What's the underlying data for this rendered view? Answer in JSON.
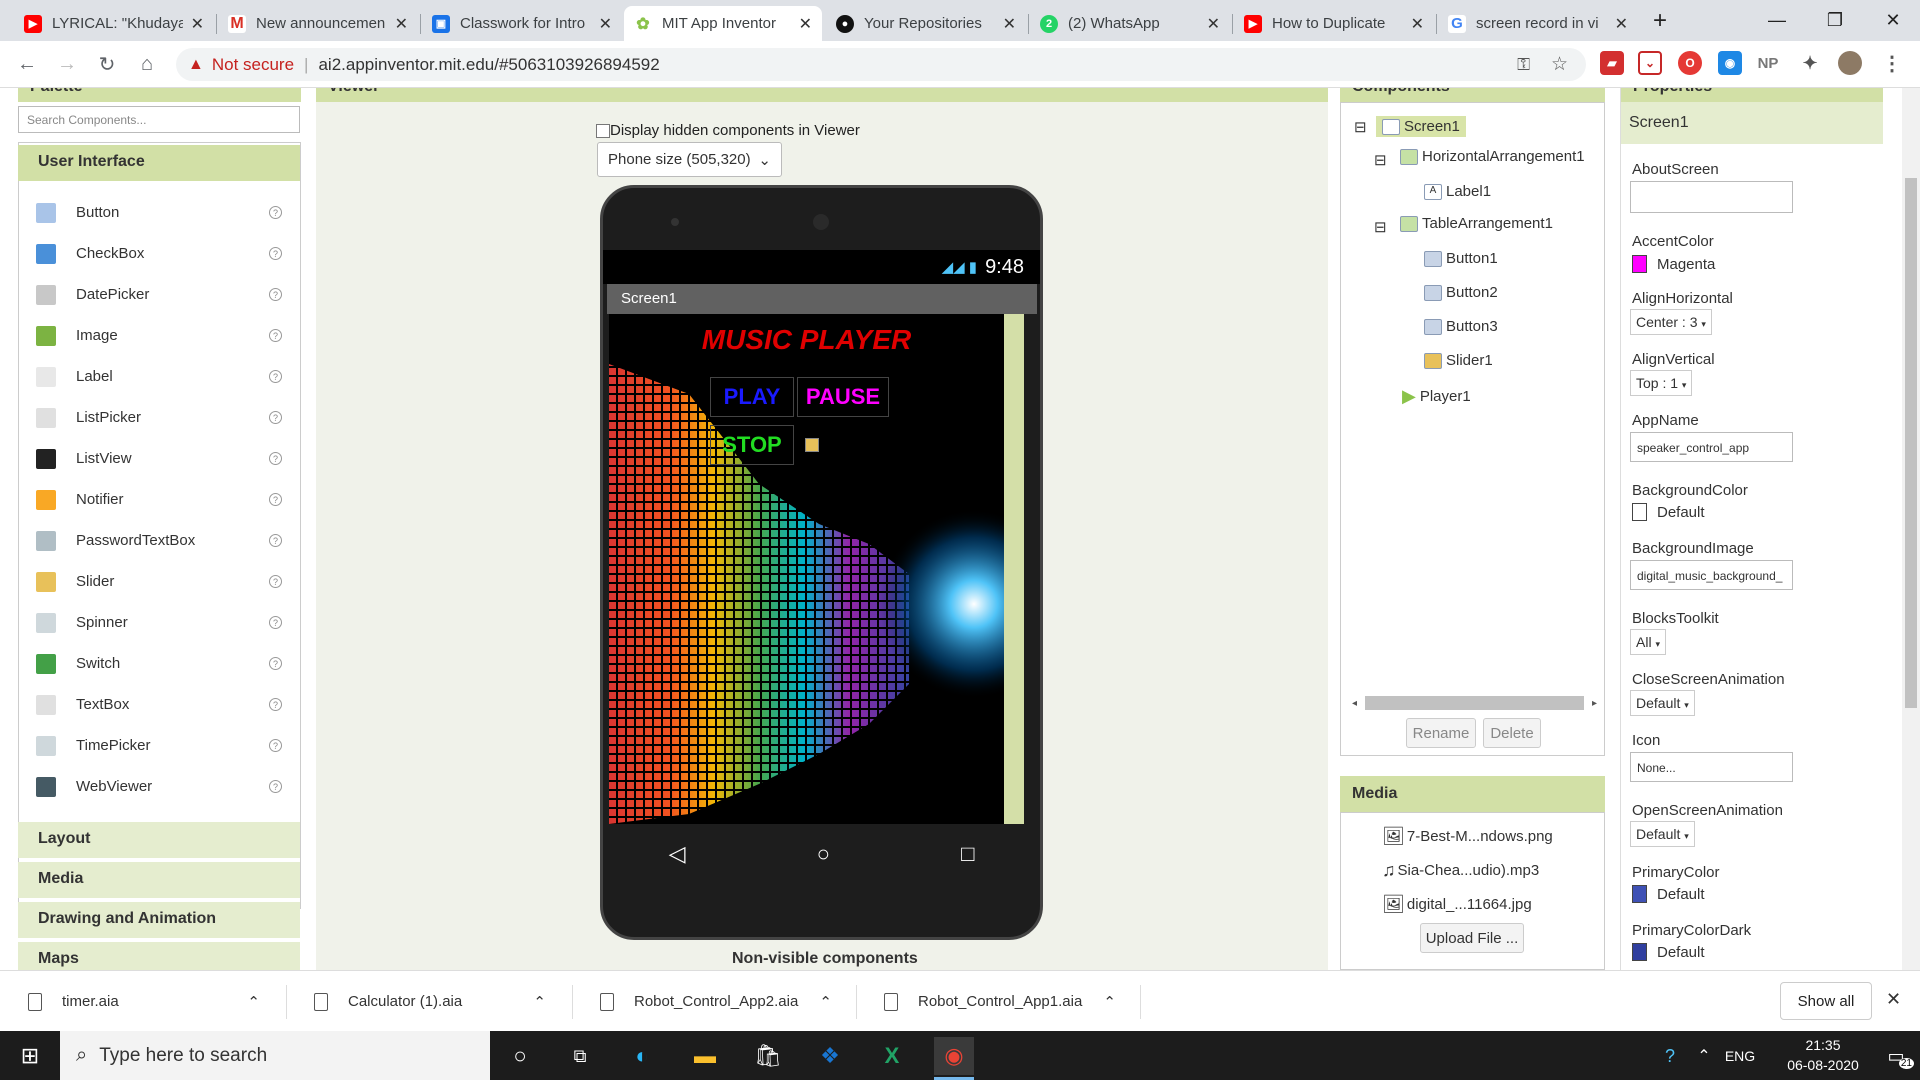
{
  "browser": {
    "tabs": [
      {
        "title": "LYRICAL: \"Khudaya",
        "icon": "youtube-icon"
      },
      {
        "title": "New announcemen",
        "icon": "gmail-icon"
      },
      {
        "title": "Classwork for Intro",
        "icon": "classroom-icon"
      },
      {
        "title": "MIT App Inventor",
        "icon": "app-inventor-icon",
        "active": true
      },
      {
        "title": "Your Repositories",
        "icon": "github-icon"
      },
      {
        "title": "(2) WhatsApp",
        "icon": "whatsapp-icon"
      },
      {
        "title": "How to Duplicate",
        "icon": "youtube-icon"
      },
      {
        "title": "screen record in vi",
        "icon": "google-icon"
      }
    ],
    "security_label": "Not secure",
    "url": "ai2.appinventor.mit.edu/#5063103926894592",
    "ext_np": "NP"
  },
  "palette": {
    "title": "Palette",
    "search_placeholder": "Search Components...",
    "category_open": "User Interface",
    "items": [
      "Button",
      "CheckBox",
      "DatePicker",
      "Image",
      "Label",
      "ListPicker",
      "ListView",
      "Notifier",
      "PasswordTextBox",
      "Slider",
      "Spinner",
      "Switch",
      "TextBox",
      "TimePicker",
      "WebViewer"
    ],
    "help": "?",
    "categories_closed": [
      "Layout",
      "Media",
      "Drawing and Animation",
      "Maps"
    ]
  },
  "viewer": {
    "title": "Viewer",
    "hidden_label": "Display hidden components in Viewer",
    "phone_size": "Phone size (505,320)",
    "time": "9:48",
    "screen_title": "Screen1",
    "app_title": "MUSIC PLAYER",
    "btn_play": "PLAY",
    "btn_pause": "PAUSE",
    "btn_stop": "STOP",
    "nonvisible": "Non-visible components"
  },
  "components": {
    "title": "Components",
    "tree": [
      "Screen1",
      "HorizontalArrangement1",
      "Label1",
      "TableArrangement1",
      "Button1",
      "Button2",
      "Button3",
      "Slider1",
      "Player1"
    ],
    "rename": "Rename",
    "delete": "Delete"
  },
  "media": {
    "title": "Media",
    "files": [
      "7-Best-M...ndows.png",
      "Sia-Chea...udio).mp3",
      "digital_...11664.jpg"
    ],
    "upload": "Upload File ..."
  },
  "properties": {
    "title": "Properties",
    "screen": "Screen1",
    "about_label": "AboutScreen",
    "accent_label": "AccentColor",
    "accent_value": "Magenta",
    "accent_color": "#ff00ff",
    "alignh_label": "AlignHorizontal",
    "alignh_value": "Center : 3",
    "alignv_label": "AlignVertical",
    "alignv_value": "Top : 1",
    "appname_label": "AppName",
    "appname_value": "speaker_control_app",
    "bgcolor_label": "BackgroundColor",
    "bgcolor_value": "Default",
    "bgimg_label": "BackgroundImage",
    "bgimg_value": "digital_music_background_",
    "blocks_label": "BlocksToolkit",
    "blocks_value": "All",
    "close_label": "CloseScreenAnimation",
    "close_value": "Default",
    "icon_label": "Icon",
    "icon_value": "None...",
    "open_label": "OpenScreenAnimation",
    "open_value": "Default",
    "primary_label": "PrimaryColor",
    "primary_value": "Default",
    "primary_color": "#3f51b5",
    "primarydark_label": "PrimaryColorDark",
    "primarydark_value": "Default",
    "primarydark_color": "#303f9f"
  },
  "downloads": {
    "files": [
      "timer.aia",
      "Calculator (1).aia",
      "Robot_Control_App2.aia",
      "Robot_Control_App1.aia"
    ],
    "show_all": "Show all"
  },
  "taskbar": {
    "search": "Type here to search",
    "lang": "ENG",
    "time": "21:35",
    "date": "06-08-2020",
    "notif": "21"
  }
}
